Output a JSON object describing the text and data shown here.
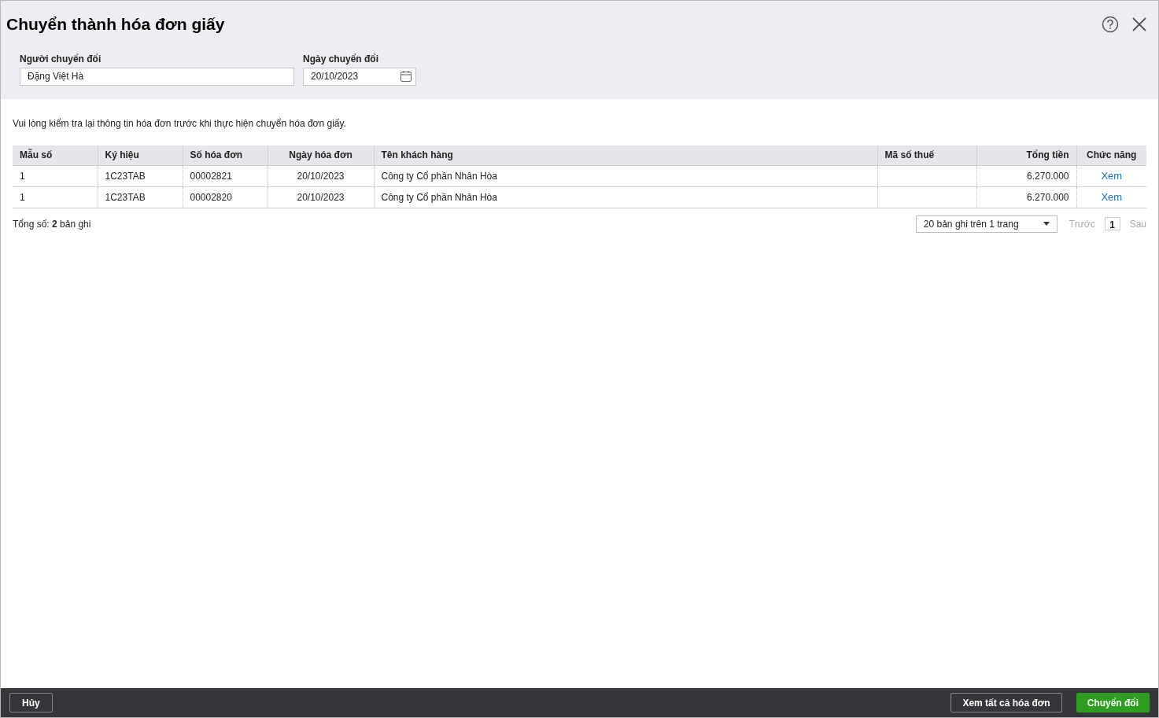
{
  "dialog": {
    "title": "Chuyển thành hóa đơn giấy"
  },
  "fields": [
    {
      "label": "Người chuyển đổi",
      "value": "Đặng Việt Hà",
      "kind": "text"
    },
    {
      "label": "Ngày chuyển đổi",
      "value": "20/10/2023",
      "kind": "date"
    }
  ],
  "notice": "Vui lòng kiểm tra lại thông tin hóa đơn trước khi thực hiện chuyển hóa đơn giấy.",
  "table": {
    "columns": [
      "Mẫu số",
      "Ký hiệu",
      "Số hóa đơn",
      "Ngày hóa đơn",
      "Tên khách hàng",
      "Mã số thuế",
      "Tổng tiền",
      "Chức năng"
    ],
    "rows": [
      {
        "cells": [
          "1",
          "1C23TAB",
          "00002821",
          "20/10/2023",
          "Công ty Cổ phần Nhân Hòa",
          "",
          "6.270.000"
        ],
        "action": "Xem"
      },
      {
        "cells": [
          "1",
          "1C23TAB",
          "00002820",
          "20/10/2023",
          "Công ty Cổ phần Nhân Hòa",
          "",
          "6.270.000"
        ],
        "action": "Xem"
      }
    ]
  },
  "total": "Tổng số: **2** bản ghi",
  "pager": {
    "page_size": "20 bản ghi trên 1 trang",
    "prev": {
      "label": "Trước",
      "disabled": true
    },
    "pages": [
      {
        "label": "1",
        "selected": true
      }
    ],
    "next": {
      "label": "Sau",
      "disabled": true
    }
  },
  "footer": {
    "cancel": "Hủy",
    "view_all": "Xem tất cả hóa đơn",
    "convert": "Chuyển đổi"
  }
}
